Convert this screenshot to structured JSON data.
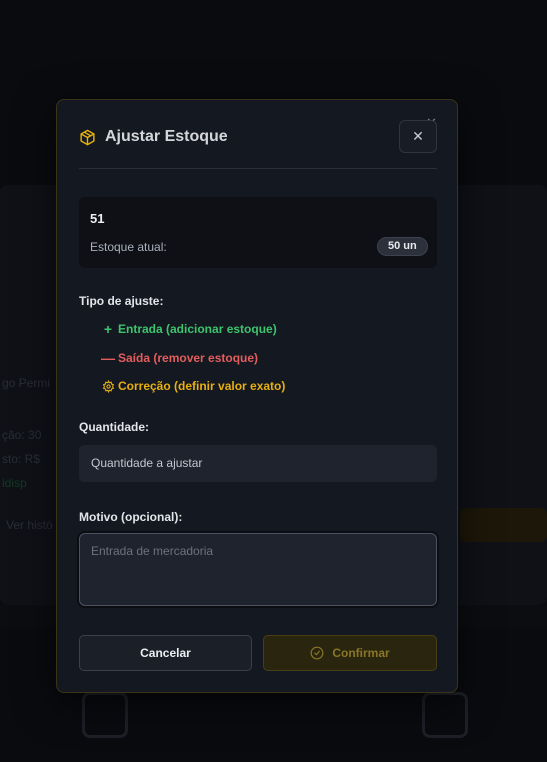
{
  "modal": {
    "title": "Ajustar Estoque",
    "icons": {
      "header": "package-icon",
      "close": "close-icon",
      "corner_close": "close-icon"
    }
  },
  "product": {
    "name": "51",
    "stock_label": "Estoque atual:",
    "stock_badge": "50 un"
  },
  "adjust_type": {
    "label": "Tipo de ajuste:",
    "options": [
      {
        "icon": "plus-icon",
        "label": "Entrada (adicionar estoque)",
        "color": "#3ec46d"
      },
      {
        "icon": "minus-icon",
        "label": "Saída (remover estoque)",
        "color": "#e35d5d"
      },
      {
        "icon": "gear-icon",
        "label": "Correção (definir valor exato)",
        "color": "#e6b012"
      }
    ]
  },
  "quantity": {
    "label": "Quantidade:",
    "placeholder": "Quantidade a ajustar"
  },
  "reason": {
    "label": "Motivo (opcional):",
    "placeholder": "Entrada de mercadoria"
  },
  "actions": {
    "cancel_label": "Cancelar",
    "confirm_label": "Confirmar",
    "confirm_icon": "check-circle-icon"
  },
  "colors": {
    "accent": "#e6b012",
    "modal_bg": "#141821",
    "page_bg": "#0a0b0f"
  }
}
